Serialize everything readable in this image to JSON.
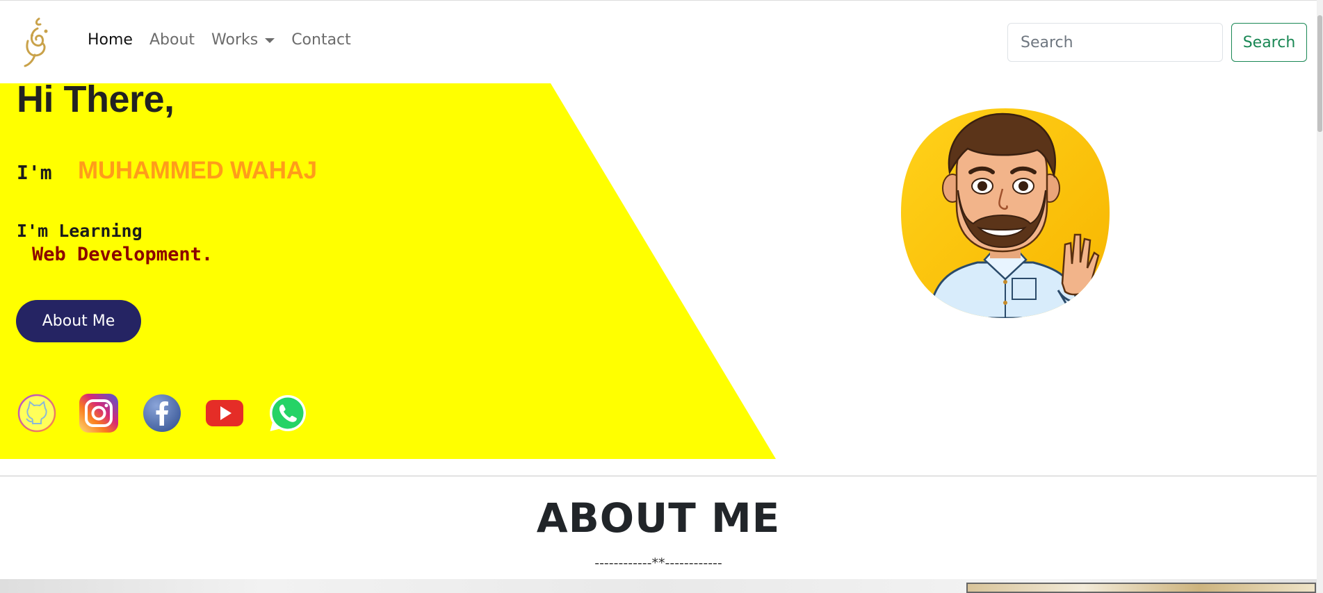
{
  "nav": {
    "items": [
      {
        "label": "Home",
        "active": true
      },
      {
        "label": "About",
        "active": false
      },
      {
        "label": "Works",
        "active": false,
        "dropdown": true
      },
      {
        "label": "Contact",
        "active": false
      }
    ],
    "search_placeholder": "Search",
    "search_button": "Search"
  },
  "hero": {
    "greeting": "Hi There,",
    "im_label": "I'm",
    "name": "MUHAMMED WAHAJ",
    "learning_label": "I'm Learning",
    "learning_value": "Web Development.",
    "about_button": "About Me",
    "social_icons": [
      "github-icon",
      "instagram-icon",
      "facebook-icon",
      "youtube-icon",
      "whatsapp-icon"
    ]
  },
  "about": {
    "heading": "ABOUT ME",
    "separator": "------------**------------"
  },
  "colors": {
    "hero_bg": "#ffff00",
    "name": "#ff9c1a",
    "learning_value": "#8b0000",
    "about_button": "#252463",
    "search_button": "#198754",
    "logo": "#c9a24a"
  }
}
